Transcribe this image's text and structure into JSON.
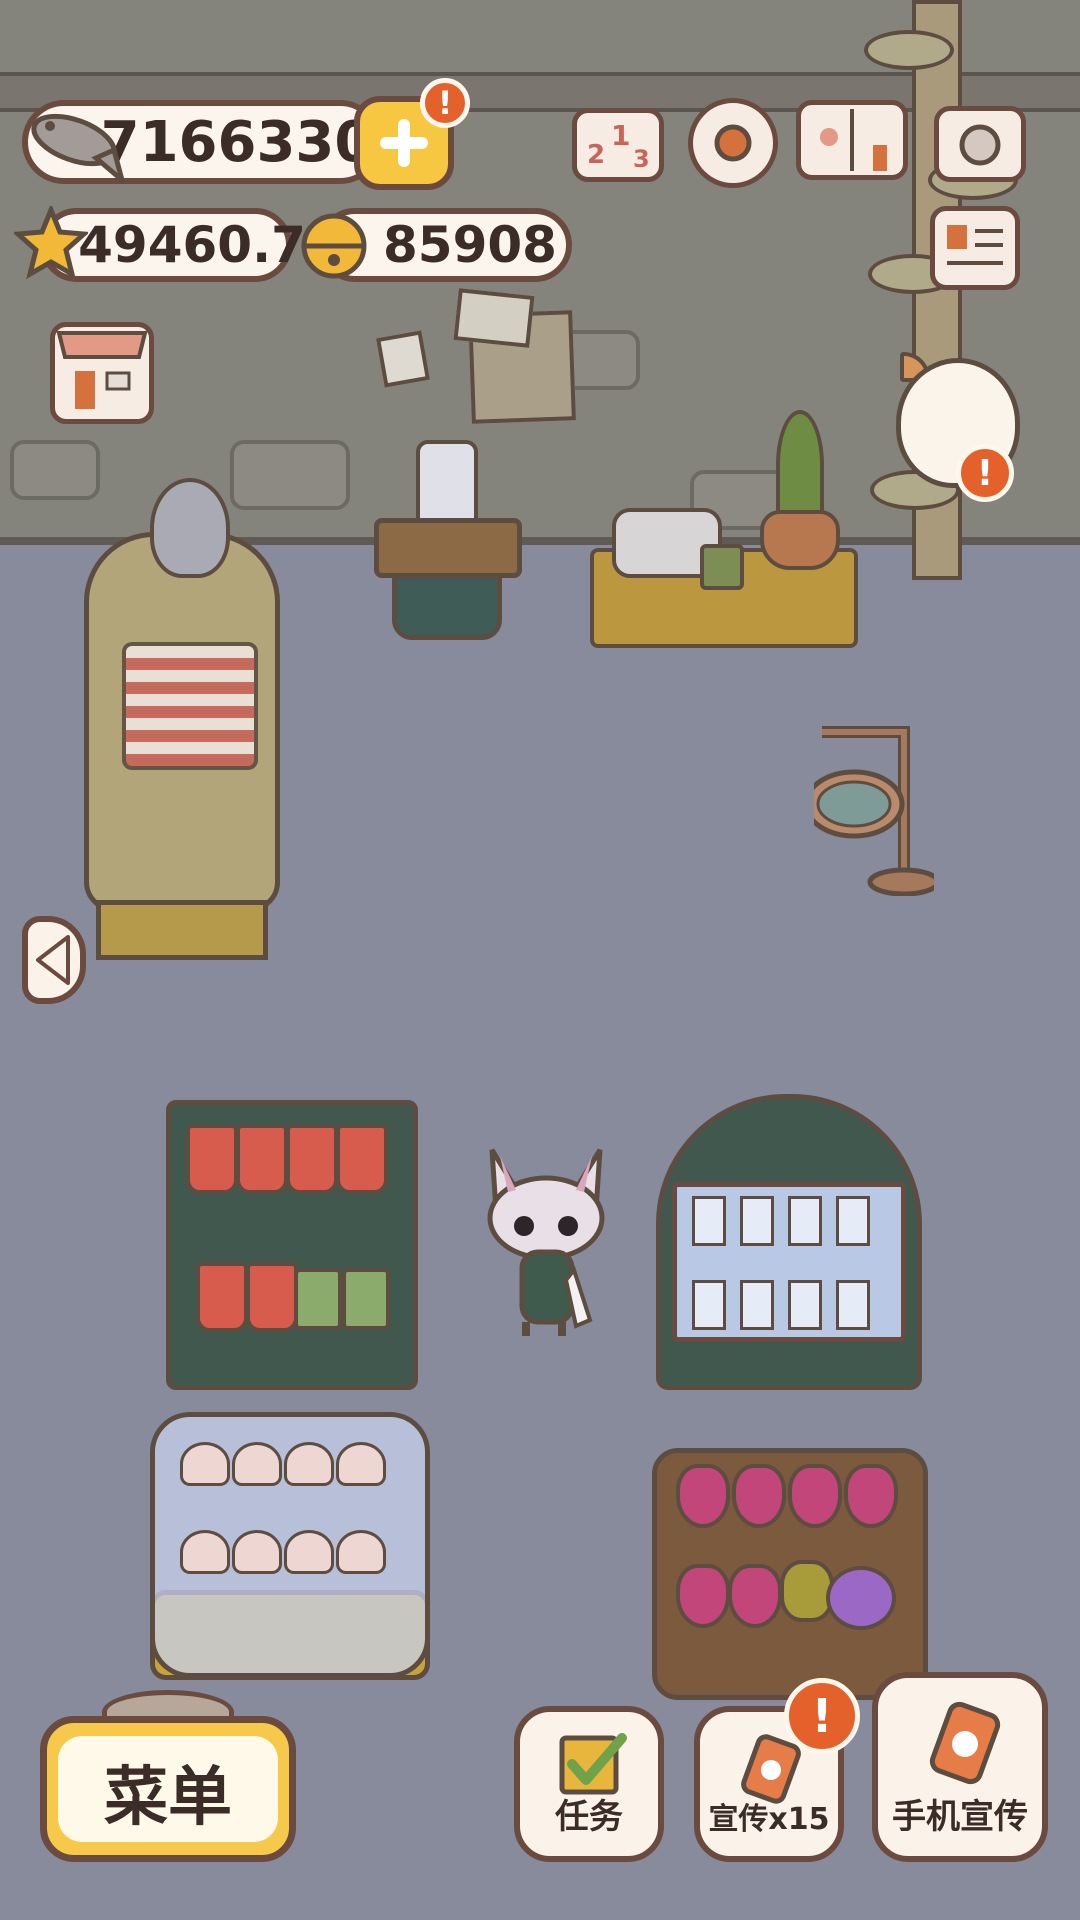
{
  "currency": {
    "fish": "7166330",
    "stars": "49460.7",
    "bells": "85908"
  },
  "alerts": {
    "plus": "!",
    "patron_cat": "!",
    "promo": "!"
  },
  "bottom_bar": {
    "menu_label": "菜单",
    "task_label": "任务",
    "promo_label": "宣传x15",
    "phone_promo_label": "手机宣传"
  },
  "colors": {
    "accent_yellow": "#f6c94a",
    "alert_orange": "#e5612b",
    "outline_brown": "#6b4a3f",
    "floor": "#878b9c",
    "wall": "#84837c"
  },
  "icons": {
    "top_bar": [
      "fish-icon",
      "plus-icon",
      "ranking-icon",
      "settings-gear-icon",
      "paw-book-icon",
      "camera-icon"
    ],
    "side": [
      "newspaper-icon",
      "shop-icon",
      "left-arrow-icon"
    ],
    "bottom": [
      "clipboard-check-icon",
      "phone-paw-icon",
      "phone-paw-icon"
    ]
  }
}
